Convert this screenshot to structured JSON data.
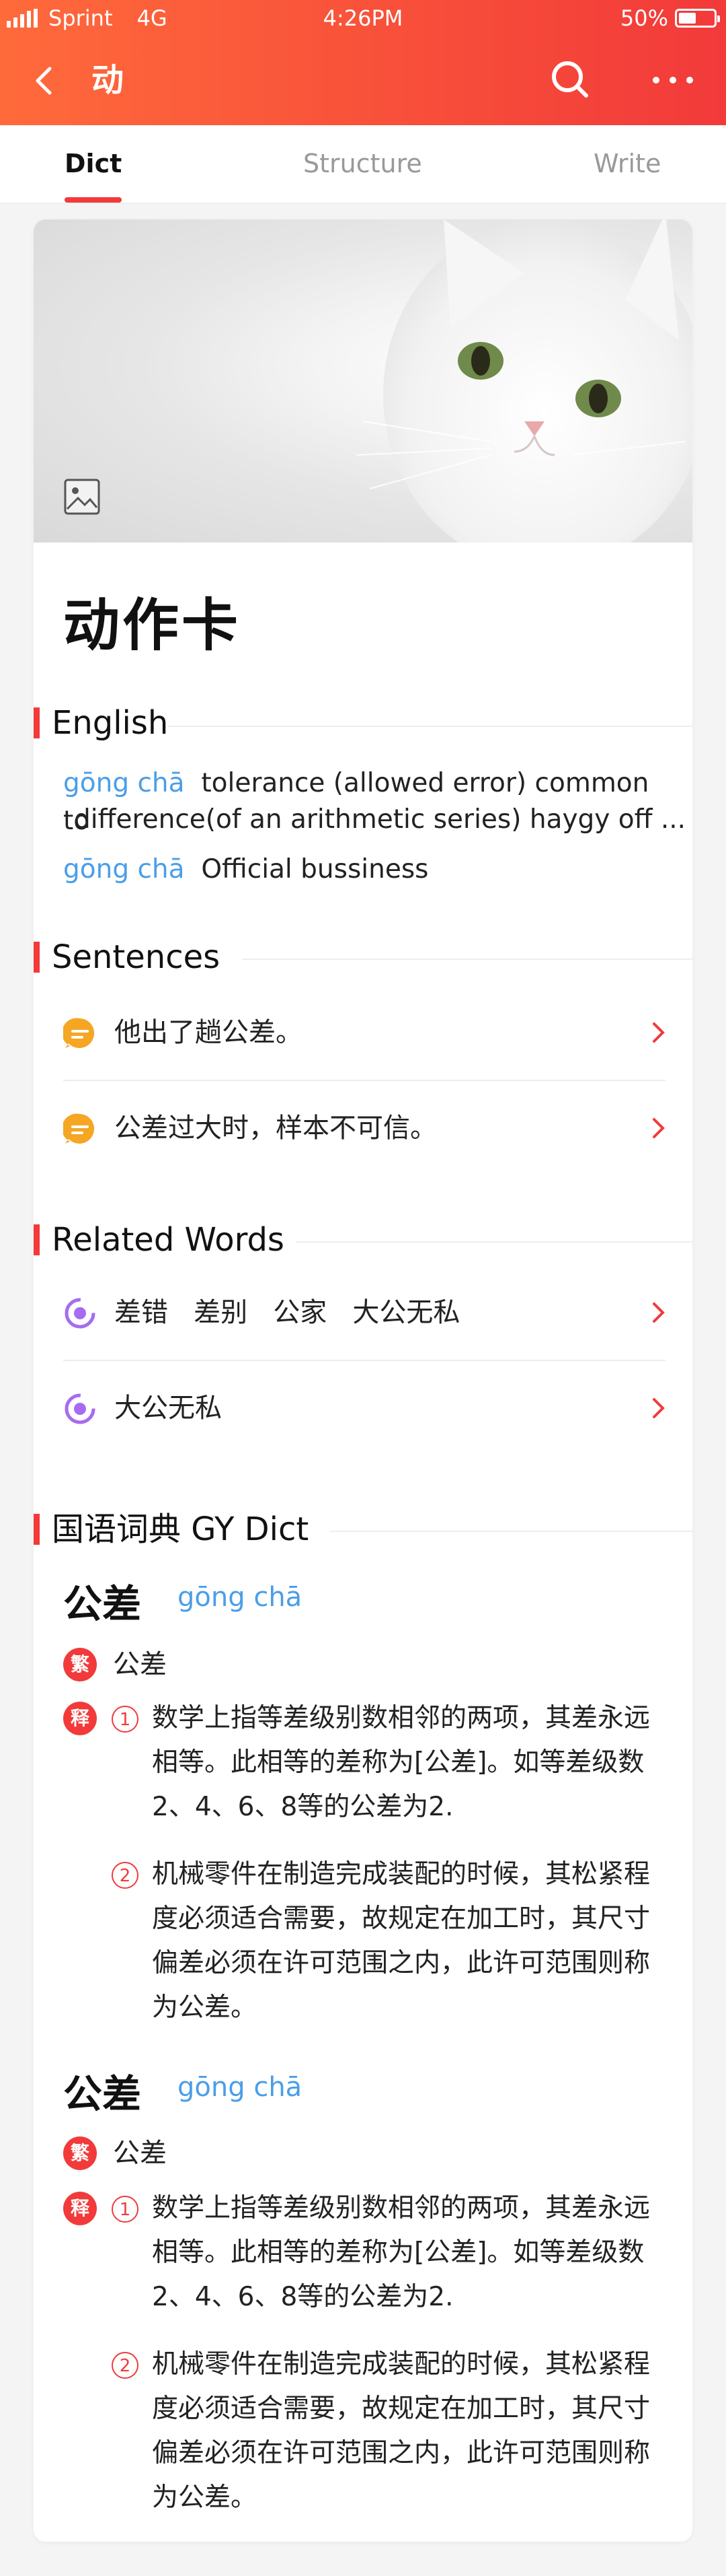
{
  "status_bar": {
    "carrier": "Sprint",
    "network": "4G",
    "time": "4:26PM",
    "battery": "50%",
    "battery_level": 0.5
  },
  "nav": {
    "title": "动",
    "icons": {
      "back": "back-icon",
      "search": "search-icon",
      "more": "more-icon"
    }
  },
  "tabs": [
    {
      "label": "Dict",
      "active": true
    },
    {
      "label": "Structure",
      "active": false
    },
    {
      "label": "Write",
      "active": false
    }
  ],
  "card": {
    "word": "动作卡",
    "english": {
      "title": "English",
      "rows": [
        {
          "pinyin": "gōng chā",
          "text": "tolerance (allowed error) common to",
          "text2": "difference(of an arithmetic series) haygy off ..."
        },
        {
          "pinyin": "gōng chā",
          "text": "Official bussiness"
        }
      ]
    },
    "sentences": {
      "title": "Sentences",
      "items": [
        "他出了趟公差。",
        "公差过大时，样本不可信。"
      ]
    },
    "related": {
      "title": "Related Words",
      "items": [
        "差错   差别   公家   大公无私",
        "大公无私"
      ]
    },
    "gy_dict": {
      "title": "国语词典 GY Dict",
      "entries": [
        {
          "word": "公差",
          "pinyin": "gōng chā",
          "trad_badge": "繁",
          "trad": "公差",
          "def_badge": "释",
          "defs": [
            {
              "num": "1",
              "lines": [
                "数学上指等差级别数相邻的两项，其差永远",
                "相等。此相等的差称为[公差]。如等差级数",
                "2、4、6、8等的公差为2."
              ]
            },
            {
              "num": "2",
              "lines": [
                "机械零件在制造完成装配的时候，其松紧程",
                "度必须适合需要，故规定在加工时，其尺寸",
                "偏差必须在许可范围之内，此许可范围则称",
                "为公差。"
              ]
            }
          ]
        },
        {
          "word": "公差",
          "pinyin": "gōng chā",
          "trad_badge": "繁",
          "trad": "公差",
          "def_badge": "释",
          "defs": [
            {
              "num": "1",
              "lines": [
                "数学上指等差级别数相邻的两项，其差永远",
                "相等。此相等的差称为[公差]。如等差级数",
                "2、4、6、8等的公差为2."
              ]
            },
            {
              "num": "2",
              "lines": [
                "机械零件在制造完成装配的时候，其松紧程",
                "度必须适合需要，故规定在加工时，其尺寸",
                "偏差必须在许可范围之内，此许可范围则称",
                "为公差。"
              ]
            }
          ]
        }
      ]
    }
  },
  "colors": {
    "accent": "#f23a3a",
    "gradient_start": "#ff6a3b",
    "pinyin": "#4a9ee8",
    "sentence_icon": "#f5a623",
    "related_icon": "#a66cf0"
  }
}
